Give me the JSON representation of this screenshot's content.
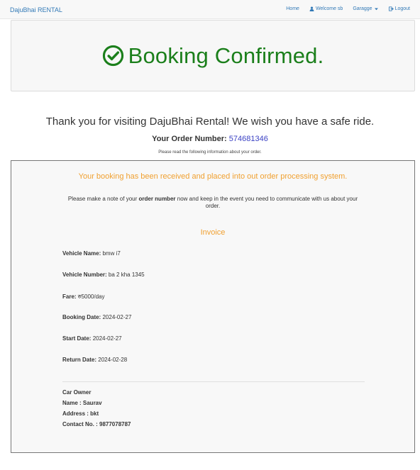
{
  "navbar": {
    "brand": "DajuBhai RENTAL",
    "home": "Home",
    "welcome": "Welcome sb",
    "garage": "Garagge",
    "logout": "Logout"
  },
  "header": {
    "title": "Booking Confirmed."
  },
  "message": {
    "thanks": "Thank you for visiting DajuBhai Rental! We wish you have a safe ride.",
    "order_label": "Your Order Number:",
    "order_number": "574681346",
    "read_note": "Please read the following information about your order."
  },
  "panel": {
    "received": "Your booking has been received and placed into out order processing system.",
    "note_before": "Please make a note of your ",
    "note_bold": "order number",
    "note_after": " now and keep in the event you need to communicate with us about your order.",
    "invoice_title": "Invoice",
    "fields": {
      "vehicle_name_label": "Vehicle Name:",
      "vehicle_name": "bmw i7",
      "vehicle_number_label": "Vehicle Number:",
      "vehicle_number": "ba 2 kha 1345",
      "fare_label": "Fare:",
      "fare": "रु5000/day",
      "booking_date_label": "Booking Date:",
      "booking_date": "2024-02-27",
      "start_date_label": "Start Date:",
      "start_date": "2024-02-27",
      "return_date_label": "Return Date:",
      "return_date": "2024-02-28"
    },
    "owner": {
      "heading": "Car Owner",
      "name": "Name : Saurav",
      "address": "Address : bkt",
      "contact": "Contact No. : 9877078787"
    }
  },
  "colors": {
    "brand_blue": "#337ab7",
    "confirm_green": "#1b7f1b",
    "accent_orange": "#f0a030",
    "order_blue": "#3b42c4"
  }
}
